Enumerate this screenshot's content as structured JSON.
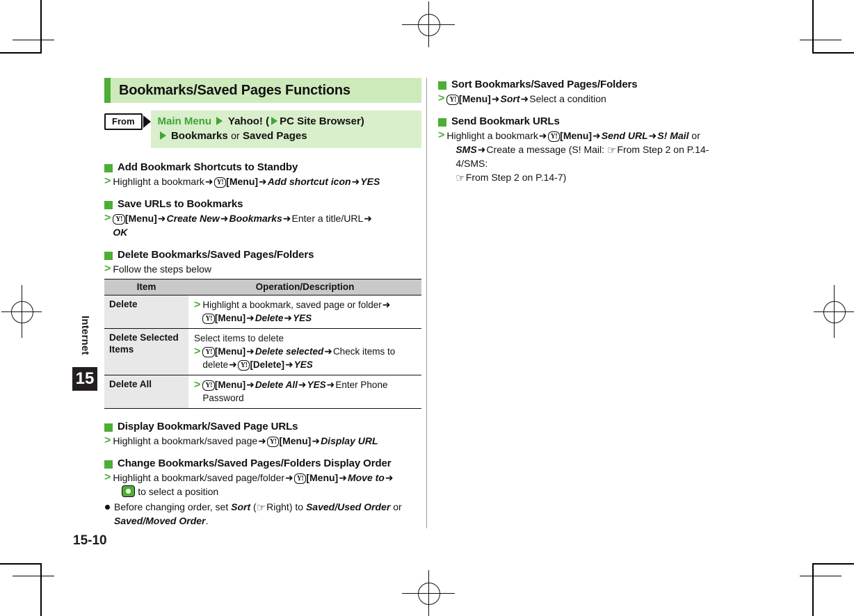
{
  "document": {
    "chapter_name": "Internet",
    "chapter_number": "15",
    "page_number": "15-10"
  },
  "banner": {
    "title": "Bookmarks/Saved Pages Functions"
  },
  "from_path": {
    "badge_label": "From",
    "line1_a": "Main Menu",
    "line1_b": "Yahoo! (",
    "line1_c": "PC Site Browser)",
    "line2_a": "Bookmarks",
    "line2_or": "or",
    "line2_b": "Saved Pages"
  },
  "left_column": {
    "sections": [
      {
        "heading": "Add Bookmark Shortcuts to Standby",
        "step_pre": "Highlight a bookmark",
        "key": "Y!",
        "step_menu": "[Menu]",
        "step_rest_1": "Add shortcut icon",
        "step_rest_2": "YES"
      },
      {
        "heading": "Save URLs to Bookmarks",
        "key": "Y!",
        "step_menu": "[Menu]",
        "step_a": "Create New",
        "step_b": "Bookmarks",
        "step_c": "Enter a title/URL",
        "step_d": "OK"
      },
      {
        "heading": "Delete Bookmarks/Saved Pages/Folders",
        "step_pre": "Follow the steps below"
      }
    ],
    "table": {
      "headers": [
        "Item",
        "Operation/Description"
      ],
      "rows": [
        {
          "item": "Delete",
          "line1": "Highlight a bookmark, saved page or folder",
          "key": "Y!",
          "menu": "[Menu]",
          "op_a": "Delete",
          "op_b": "YES"
        },
        {
          "item": "Delete Selected Items",
          "pre": "Select items to delete",
          "key": "Y!",
          "menu": "[Menu]",
          "op_a": "Delete selected",
          "op_b": "Check items to delete",
          "key2": "Y!",
          "menu2": "[Delete]",
          "op_c": "YES"
        },
        {
          "item": "Delete All",
          "key": "Y!",
          "menu": "[Menu]",
          "op_a": "Delete All",
          "op_b": "YES",
          "op_c": "Enter Phone Password"
        }
      ]
    },
    "sections_bottom": [
      {
        "heading": "Display Bookmark/Saved Page URLs",
        "step_pre": "Highlight a bookmark/saved page",
        "key": "Y!",
        "step_menu": "[Menu]",
        "step_rest_1": "Display URL"
      },
      {
        "heading": "Change Bookmarks/Saved Pages/Folders Display Order",
        "step_pre": "Highlight a bookmark/saved page/folder",
        "key": "Y!",
        "step_menu": "[Menu]",
        "step_rest_1": "Move to",
        "step_rest_2": "to select a position",
        "note_a": "Before changing order, set",
        "note_sort": "Sort",
        "note_b": "Right) to",
        "note_c": "Saved/Used Order",
        "note_or": "or",
        "note_d": "Saved/Moved Order",
        "note_end": "."
      }
    ]
  },
  "right_column": {
    "sections": [
      {
        "heading": "Sort Bookmarks/Saved Pages/Folders",
        "key": "Y!",
        "step_menu": "[Menu]",
        "step_a": "Sort",
        "step_b": "Select a condition"
      },
      {
        "heading": "Send Bookmark URLs",
        "step_pre": "Highlight a bookmark",
        "key": "Y!",
        "step_menu": "[Menu]",
        "step_a": "Send URL",
        "step_b": "S! Mail",
        "step_or": "or",
        "step_c": "SMS",
        "step_d": "Create a message (S! Mail:",
        "ref1": "From Step 2 on P.14-4/SMS:",
        "ref2": "From Step 2 on P.14-7)"
      }
    ]
  },
  "colors": {
    "accent_green": "#4cae36",
    "banner_bg": "#cdeabb",
    "path_panel_bg": "#d9eecb",
    "table_header_bg": "#c9c9c9",
    "table_col1_bg": "#e8e8e8",
    "chapter_tab_bg": "#231f20"
  },
  "glyphs": {
    "arrow": "➜",
    "hand": "☞",
    "gt": ">"
  }
}
